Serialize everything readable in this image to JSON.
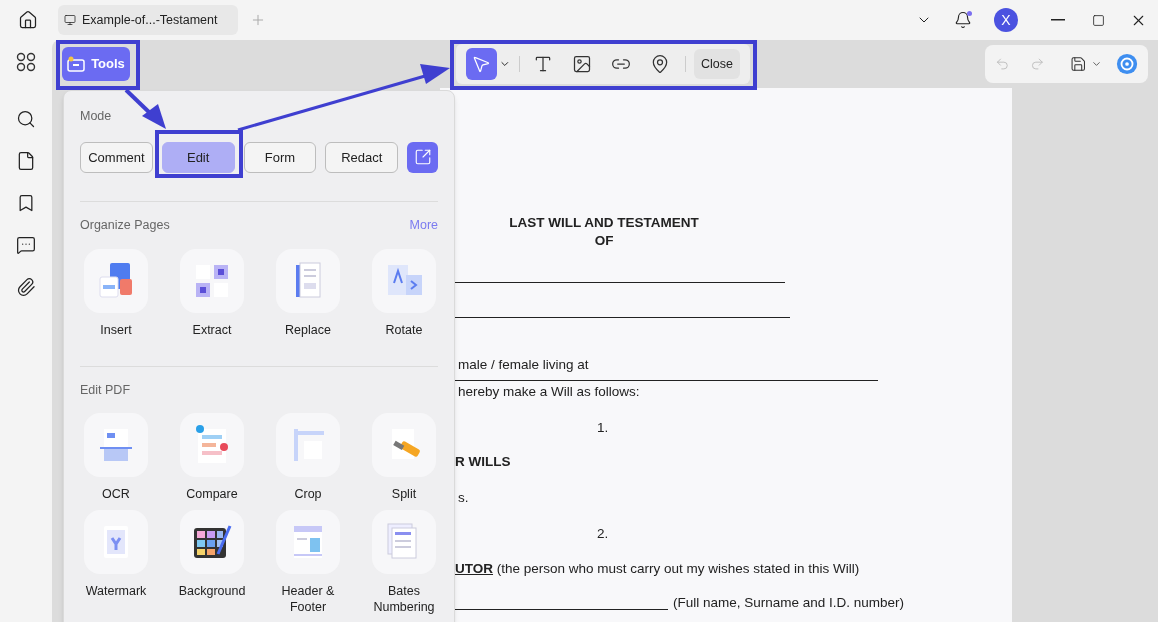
{
  "tab": {
    "title": "Example-of...-Testament"
  },
  "user": {
    "initial": "X"
  },
  "tools_button": {
    "label": "Tools",
    "selected": true
  },
  "toolbar": {
    "tools": [
      {
        "kind": "select",
        "selected": true
      },
      {
        "kind": "text",
        "selected": false
      },
      {
        "kind": "image",
        "selected": false
      },
      {
        "kind": "link",
        "selected": false
      },
      {
        "kind": "pin",
        "selected": false
      }
    ],
    "close": "Close"
  },
  "panel": {
    "mode_title": "Mode",
    "modes": [
      {
        "label": "Comment",
        "selected": false
      },
      {
        "label": "Edit",
        "selected": true
      },
      {
        "label": "Form",
        "selected": false
      },
      {
        "label": "Redact",
        "selected": false
      }
    ],
    "sections": [
      {
        "title": "Organize Pages",
        "more": "More",
        "items": [
          {
            "label": "Insert",
            "kind": "insert"
          },
          {
            "label": "Extract",
            "kind": "extract"
          },
          {
            "label": "Replace",
            "kind": "replace"
          },
          {
            "label": "Rotate",
            "kind": "rotate"
          }
        ]
      },
      {
        "title": "Edit PDF",
        "items": [
          {
            "label": "OCR",
            "kind": "ocr"
          },
          {
            "label": "Compare",
            "kind": "compare"
          },
          {
            "label": "Crop",
            "kind": "crop"
          },
          {
            "label": "Split",
            "kind": "split"
          },
          {
            "label": "Watermark",
            "kind": "watermark"
          },
          {
            "label": "Background",
            "kind": "background"
          },
          {
            "label": "Header & Footer",
            "kind": "header"
          },
          {
            "label": "Bates Numbering",
            "kind": "bates"
          }
        ]
      }
    ]
  },
  "document": {
    "title": "LAST WILL AND TESTAMENT",
    "subtitle": "OF",
    "blocks": [
      {
        "kind": "rule"
      },
      {
        "kind": "rule"
      },
      {
        "kind": "text",
        "text": "male / female living at"
      },
      {
        "kind": "rule"
      },
      {
        "kind": "text",
        "text": "hereby make a Will as follows:"
      },
      {
        "kind": "number",
        "text": "1."
      },
      {
        "kind": "heading",
        "text": "R WILLS"
      },
      {
        "kind": "text",
        "text": "s."
      },
      {
        "kind": "number",
        "text": "2."
      },
      {
        "kind": "clause",
        "heading": "UTOR",
        "text": " (the person who must carry out my wishes stated in this Will)"
      },
      {
        "kind": "fill",
        "text": "(Full name, Surname and I.D. number)"
      }
    ]
  }
}
